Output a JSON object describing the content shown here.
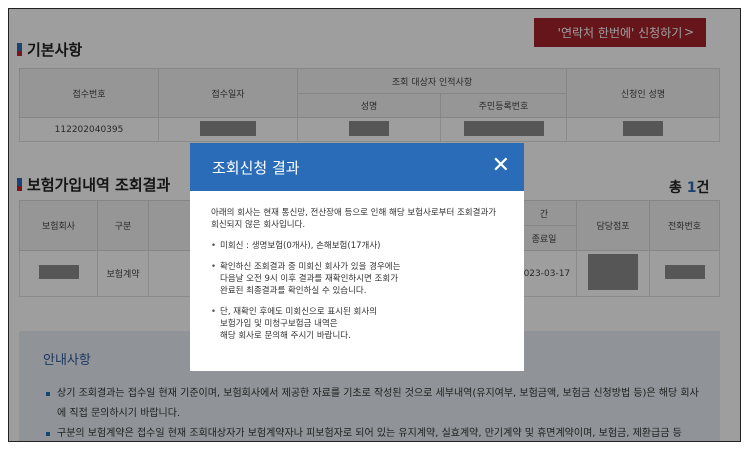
{
  "apply_button": {
    "label": "'연락처 한번에' 신청하기"
  },
  "basic": {
    "title": "기본사항",
    "headers": {
      "receipt_no": "접수번호",
      "receipt_date": "접수일자",
      "target_group": "조회 대상자 인적사항",
      "name": "성명",
      "rrn": "주민등록번호",
      "applicant": "신청인 성명"
    },
    "row": {
      "receipt_no": "112202040395"
    }
  },
  "results": {
    "title": "보험가입내역 조회결과",
    "total_prefix": "총 ",
    "total_count": "1",
    "total_suffix": "건",
    "headers": {
      "company": "보험회사",
      "type": "구분",
      "period": "간",
      "end_date": "종료일",
      "branch": "담당점포",
      "phone": "전화번호"
    },
    "row": {
      "type": "보험계약",
      "end_date": "2023-03-17"
    }
  },
  "guide": {
    "title": "안내사항",
    "items": [
      "상기 조회결과는 접수일 현재 기준이며, 보험회사에서 제공한 자료를 기초로 작성된 것으로 세부내역(유지여부, 보험금액, 보험금 신청방법 등)은 해당 회사에 직접 문의하시기 바랍니다.",
      "구분의 보험계약은 접수일 현재 조회대상자가 보험계약자나 피보험자로 되어 있는 유지계약, 실효계약, 만기계약 및 휴면계약이며, 보험금, 제환급금 등"
    ]
  },
  "modal": {
    "title": "조회신청 결과",
    "close_label": "✕",
    "intro": "아래의 회사는 현재 통신망, 전산장애 등으로 인해 해당 보험사로부터 조회결과가 회신되지 않은 회사입니다.",
    "items": [
      "미회신 : 생명보험(0개사), 손해보험(17개사)",
      "확인하신 조회결과 중 미회신 회사가 있을 경우에는\n다음날 오전 9시 이후 결과를 재확인하시면 조회가\n완료된 최종결과를 확인하실 수 있습니다.",
      "단, 재확인 후에도 미회신으로 표시된 회사의\n보험가입 및 미청구보험금 내역은\n해당 회사로 문의해 주시기 바랍니다."
    ]
  },
  "colors": {
    "accent_blue": "#2b6cb8",
    "brand_red": "#a5222b"
  }
}
